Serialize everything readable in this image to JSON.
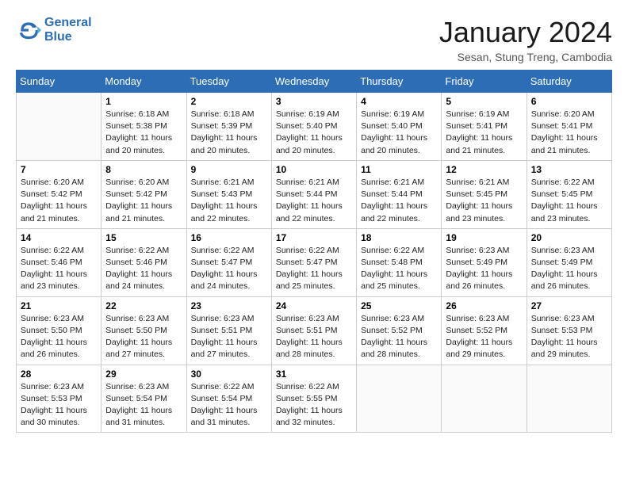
{
  "logo": {
    "line1": "General",
    "line2": "Blue"
  },
  "title": "January 2024",
  "subtitle": "Sesan, Stung Treng, Cambodia",
  "weekdays": [
    "Sunday",
    "Monday",
    "Tuesday",
    "Wednesday",
    "Thursday",
    "Friday",
    "Saturday"
  ],
  "weeks": [
    [
      {
        "day": "",
        "info": ""
      },
      {
        "day": "1",
        "info": "Sunrise: 6:18 AM\nSunset: 5:38 PM\nDaylight: 11 hours\nand 20 minutes."
      },
      {
        "day": "2",
        "info": "Sunrise: 6:18 AM\nSunset: 5:39 PM\nDaylight: 11 hours\nand 20 minutes."
      },
      {
        "day": "3",
        "info": "Sunrise: 6:19 AM\nSunset: 5:40 PM\nDaylight: 11 hours\nand 20 minutes."
      },
      {
        "day": "4",
        "info": "Sunrise: 6:19 AM\nSunset: 5:40 PM\nDaylight: 11 hours\nand 20 minutes."
      },
      {
        "day": "5",
        "info": "Sunrise: 6:19 AM\nSunset: 5:41 PM\nDaylight: 11 hours\nand 21 minutes."
      },
      {
        "day": "6",
        "info": "Sunrise: 6:20 AM\nSunset: 5:41 PM\nDaylight: 11 hours\nand 21 minutes."
      }
    ],
    [
      {
        "day": "7",
        "info": "Sunrise: 6:20 AM\nSunset: 5:42 PM\nDaylight: 11 hours\nand 21 minutes."
      },
      {
        "day": "8",
        "info": "Sunrise: 6:20 AM\nSunset: 5:42 PM\nDaylight: 11 hours\nand 21 minutes."
      },
      {
        "day": "9",
        "info": "Sunrise: 6:21 AM\nSunset: 5:43 PM\nDaylight: 11 hours\nand 22 minutes."
      },
      {
        "day": "10",
        "info": "Sunrise: 6:21 AM\nSunset: 5:44 PM\nDaylight: 11 hours\nand 22 minutes."
      },
      {
        "day": "11",
        "info": "Sunrise: 6:21 AM\nSunset: 5:44 PM\nDaylight: 11 hours\nand 22 minutes."
      },
      {
        "day": "12",
        "info": "Sunrise: 6:21 AM\nSunset: 5:45 PM\nDaylight: 11 hours\nand 23 minutes."
      },
      {
        "day": "13",
        "info": "Sunrise: 6:22 AM\nSunset: 5:45 PM\nDaylight: 11 hours\nand 23 minutes."
      }
    ],
    [
      {
        "day": "14",
        "info": "Sunrise: 6:22 AM\nSunset: 5:46 PM\nDaylight: 11 hours\nand 23 minutes."
      },
      {
        "day": "15",
        "info": "Sunrise: 6:22 AM\nSunset: 5:46 PM\nDaylight: 11 hours\nand 24 minutes."
      },
      {
        "day": "16",
        "info": "Sunrise: 6:22 AM\nSunset: 5:47 PM\nDaylight: 11 hours\nand 24 minutes."
      },
      {
        "day": "17",
        "info": "Sunrise: 6:22 AM\nSunset: 5:47 PM\nDaylight: 11 hours\nand 25 minutes."
      },
      {
        "day": "18",
        "info": "Sunrise: 6:22 AM\nSunset: 5:48 PM\nDaylight: 11 hours\nand 25 minutes."
      },
      {
        "day": "19",
        "info": "Sunrise: 6:23 AM\nSunset: 5:49 PM\nDaylight: 11 hours\nand 26 minutes."
      },
      {
        "day": "20",
        "info": "Sunrise: 6:23 AM\nSunset: 5:49 PM\nDaylight: 11 hours\nand 26 minutes."
      }
    ],
    [
      {
        "day": "21",
        "info": "Sunrise: 6:23 AM\nSunset: 5:50 PM\nDaylight: 11 hours\nand 26 minutes."
      },
      {
        "day": "22",
        "info": "Sunrise: 6:23 AM\nSunset: 5:50 PM\nDaylight: 11 hours\nand 27 minutes."
      },
      {
        "day": "23",
        "info": "Sunrise: 6:23 AM\nSunset: 5:51 PM\nDaylight: 11 hours\nand 27 minutes."
      },
      {
        "day": "24",
        "info": "Sunrise: 6:23 AM\nSunset: 5:51 PM\nDaylight: 11 hours\nand 28 minutes."
      },
      {
        "day": "25",
        "info": "Sunrise: 6:23 AM\nSunset: 5:52 PM\nDaylight: 11 hours\nand 28 minutes."
      },
      {
        "day": "26",
        "info": "Sunrise: 6:23 AM\nSunset: 5:52 PM\nDaylight: 11 hours\nand 29 minutes."
      },
      {
        "day": "27",
        "info": "Sunrise: 6:23 AM\nSunset: 5:53 PM\nDaylight: 11 hours\nand 29 minutes."
      }
    ],
    [
      {
        "day": "28",
        "info": "Sunrise: 6:23 AM\nSunset: 5:53 PM\nDaylight: 11 hours\nand 30 minutes."
      },
      {
        "day": "29",
        "info": "Sunrise: 6:23 AM\nSunset: 5:54 PM\nDaylight: 11 hours\nand 31 minutes."
      },
      {
        "day": "30",
        "info": "Sunrise: 6:22 AM\nSunset: 5:54 PM\nDaylight: 11 hours\nand 31 minutes."
      },
      {
        "day": "31",
        "info": "Sunrise: 6:22 AM\nSunset: 5:55 PM\nDaylight: 11 hours\nand 32 minutes."
      },
      {
        "day": "",
        "info": ""
      },
      {
        "day": "",
        "info": ""
      },
      {
        "day": "",
        "info": ""
      }
    ]
  ]
}
